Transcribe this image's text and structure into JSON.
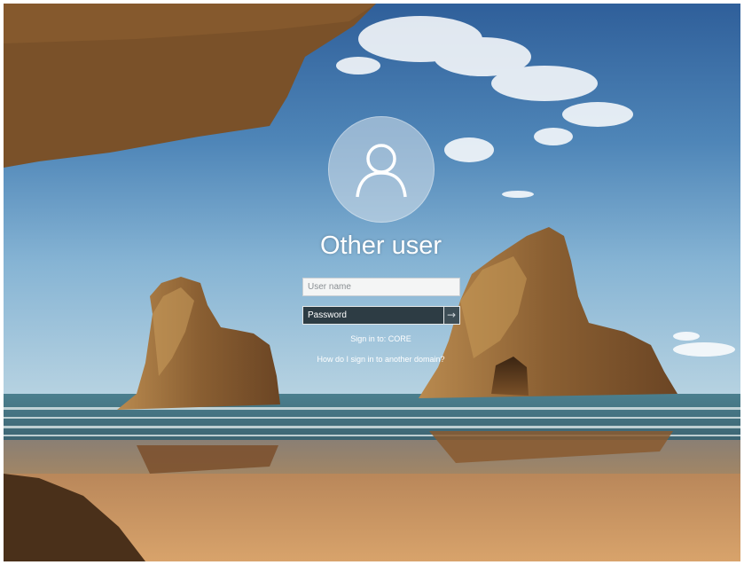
{
  "login": {
    "account_name": "Other user",
    "username_placeholder": "User name",
    "password_placeholder": "Password",
    "sign_in_to": "Sign in to: CORE",
    "other_domain_link": "How do I sign in to another domain?"
  },
  "icons": {
    "avatar": "user-silhouette-icon",
    "submit": "arrow-right-icon"
  },
  "colors": {
    "password_field": "#2d3c44",
    "username_field": "#f4f5f5",
    "text": "#ffffff"
  }
}
